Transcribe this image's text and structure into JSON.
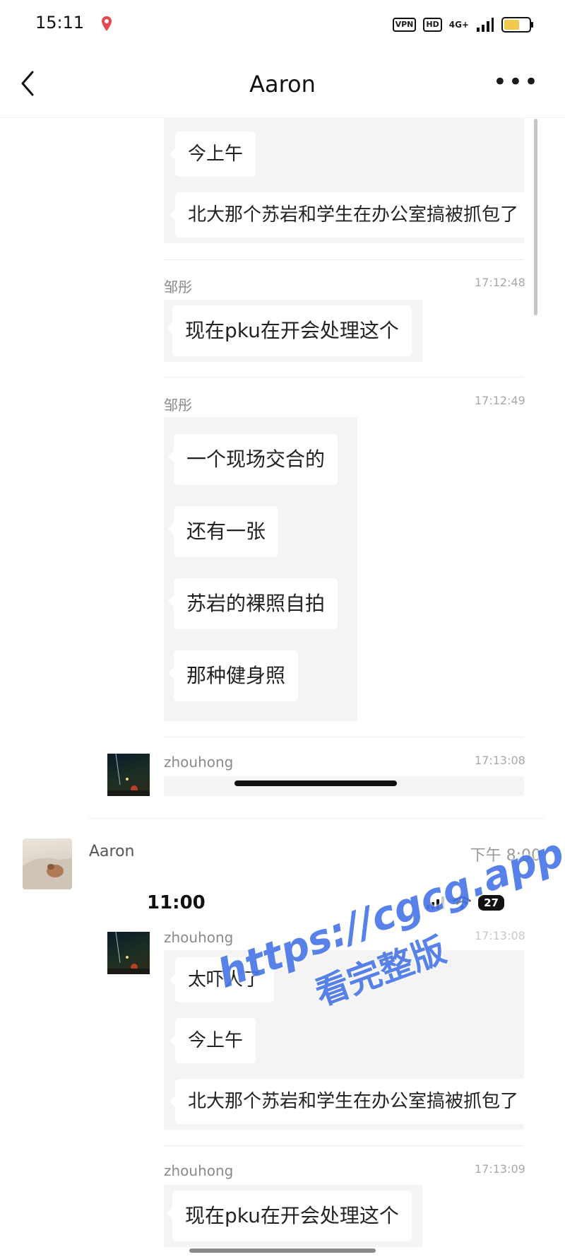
{
  "status_bar": {
    "time": "15:11",
    "vpn": "VPN",
    "hd": "HD",
    "network": "4G+"
  },
  "nav": {
    "title": "Aaron"
  },
  "record_top": {
    "bubbles": [
      "今上午",
      "北大那个苏岩和学生在办公室搞被抓包了"
    ],
    "messages": [
      {
        "sender": "邹彤",
        "time": "17:12:48",
        "bubbles": [
          "现在pku在开会处理这个"
        ]
      },
      {
        "sender": "邹彤",
        "time": "17:12:49",
        "bubbles": [
          "一个现场交合的",
          "还有一张",
          "苏岩的裸照自拍",
          "那种健身照"
        ]
      },
      {
        "sender": "zhouhong",
        "time": "17:13:08"
      }
    ]
  },
  "outer_message": {
    "sender": "Aaron",
    "time": "下午 8:00"
  },
  "embedded": {
    "status_time": "11:00",
    "battery": "27",
    "first_message": {
      "sender": "zhouhong",
      "time": "17:13:08",
      "bubbles": [
        "太吓人了",
        "今上午",
        "北大那个苏岩和学生在办公室搞被抓包了"
      ]
    },
    "second_message": {
      "sender": "zhouhong",
      "time": "17:13:09",
      "bubbles": [
        "现在pku在开会处理这个"
      ]
    }
  },
  "watermark": {
    "line1": "https://cgcg.app",
    "line2": "看完整版"
  },
  "colors": {
    "panel": "#f4f4f4",
    "bubble": "#ffffff",
    "watermark": "#4a78e8"
  },
  "icons": [
    "location-pin-icon",
    "back-chevron-icon",
    "more-dots-icon",
    "signal-icon",
    "wifi-icon",
    "battery-icon"
  ]
}
